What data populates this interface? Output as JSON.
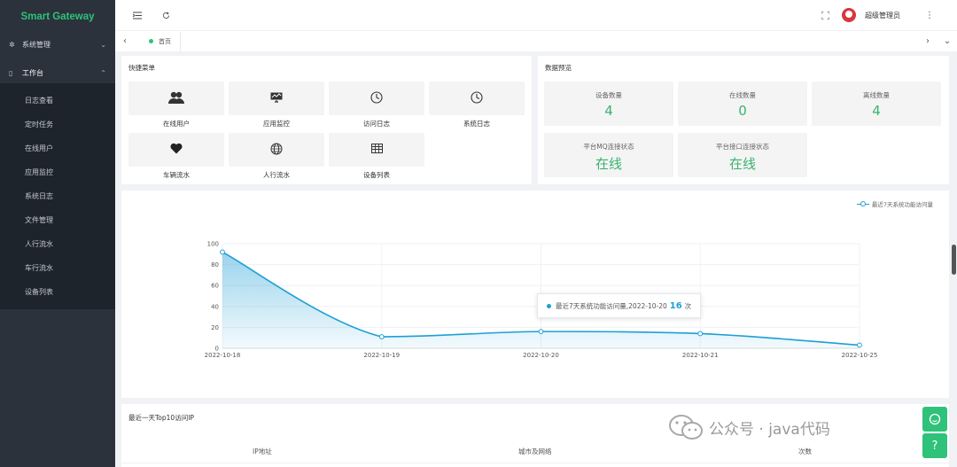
{
  "sidebar": {
    "brand": "Smart Gateway",
    "groups": [
      {
        "label": "系统管理",
        "icon": "gear-icon",
        "expanded": false
      },
      {
        "label": "工作台",
        "icon": "monitor-icon",
        "expanded": true
      }
    ],
    "items": [
      "日志查看",
      "定时任务",
      "在线用户",
      "应用监控",
      "系统日志",
      "文件管理",
      "人行流水",
      "车行流水",
      "设备列表"
    ]
  },
  "header": {
    "username": "超级管理员"
  },
  "tabs": {
    "home_label": "首页"
  },
  "quick_menu": {
    "title": "快捷菜单",
    "items": [
      {
        "label": "在线用户",
        "icon": "users-icon"
      },
      {
        "label": "应用监控",
        "icon": "monitor-chart-icon"
      },
      {
        "label": "访问日志",
        "icon": "clock-icon"
      },
      {
        "label": "系统日志",
        "icon": "clock-icon"
      },
      {
        "label": "车辆流水",
        "icon": "heart-icon"
      },
      {
        "label": "人行流水",
        "icon": "globe-icon"
      },
      {
        "label": "设备列表",
        "icon": "table-icon"
      }
    ]
  },
  "data_preview": {
    "title": "数据预览",
    "items": [
      {
        "label": "设备数量",
        "value": "4"
      },
      {
        "label": "在线数量",
        "value": "0"
      },
      {
        "label": "离线数量",
        "value": "4"
      },
      {
        "label": "平台MQ连接状态",
        "value": "在线"
      },
      {
        "label": "平台接口连接状态",
        "value": "在线"
      }
    ],
    "value_color": "#3ab36e"
  },
  "chart_data": {
    "type": "area",
    "categories": [
      "2022-10-18",
      "2022-10-19",
      "2022-10-20",
      "2022-10-21",
      "2022-10-25"
    ],
    "series": [
      {
        "name": "最近7天系统功能访问量",
        "values": [
          92,
          11,
          16,
          14,
          3
        ]
      }
    ],
    "y_ticks": [
      "0",
      "20",
      "40",
      "60",
      "80",
      "100"
    ],
    "ylim": [
      0,
      100
    ],
    "legend": "top-right",
    "color": "#1e9fd6",
    "tooltip": {
      "text": "最近7天系统功能访问量,2022-10-20",
      "value": "16",
      "unit": "次"
    }
  },
  "top10": {
    "title": "最近一天Top10访问IP",
    "columns": [
      "IP地址",
      "城市及网络",
      "次数"
    ]
  },
  "watermark": {
    "text": "公众号 · java代码"
  }
}
